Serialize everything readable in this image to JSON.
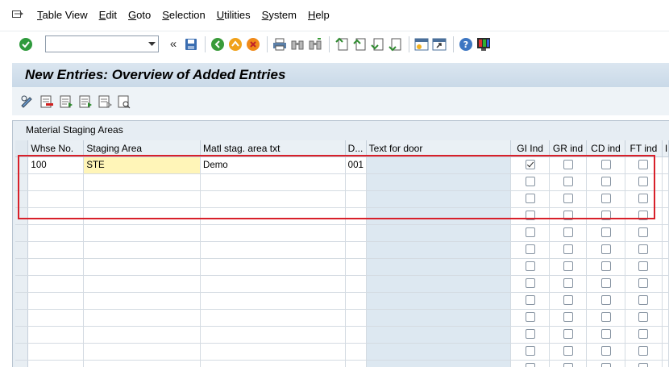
{
  "menu": {
    "items": [
      "Table View",
      "Edit",
      "Goto",
      "Selection",
      "Utilities",
      "System",
      "Help"
    ]
  },
  "toolbar": {
    "command_value": "",
    "icons": [
      "enter-icon",
      "back-icon",
      "exit-icon",
      "cancel-icon",
      "print-icon",
      "find-icon",
      "find-next-icon",
      "first-page-icon",
      "prev-page-icon",
      "next-page-icon",
      "last-page-icon",
      "create-session-icon",
      "shortcut-icon",
      "help-icon",
      "layout-icon"
    ]
  },
  "page": {
    "title": "New Entries: Overview of Added Entries"
  },
  "table": {
    "section_title": "Material Staging Areas",
    "columns": [
      "Whse No.",
      "Staging Area",
      "Matl stag. area txt",
      "D...",
      "Text for door",
      "GI Ind",
      "GR ind",
      "CD ind",
      "FT ind",
      "I"
    ],
    "rows": [
      {
        "whse": "100",
        "staging": "STE",
        "text": "Demo",
        "door": "001",
        "door_text": "",
        "gi": true,
        "gr": false,
        "cd": false,
        "ft": false
      }
    ],
    "empty_rows": 12
  },
  "colors": {
    "highlight": "#d8202a",
    "active_cell": "#fff5b8",
    "title_band": "#c9d9e8"
  }
}
